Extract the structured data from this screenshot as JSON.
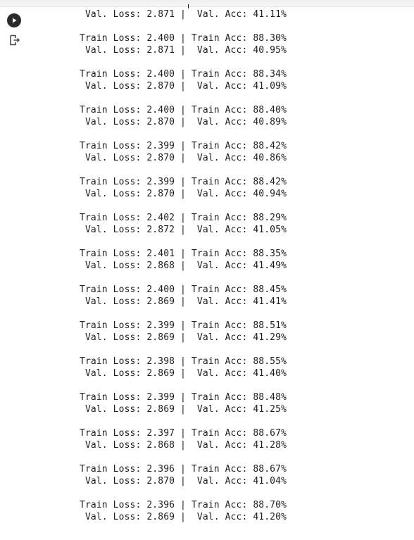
{
  "cell": {
    "run_icon": "play-circle-icon",
    "clear_output_icon": "clear-output-icon"
  },
  "output": {
    "first_val_line": " Val. Loss: 2.871 |  Val. Acc: 41.11%",
    "epochs": [
      {
        "train": "Train Loss: 2.400 | Train Acc: 88.30%",
        "val": " Val. Loss: 2.871 |  Val. Acc: 40.95%"
      },
      {
        "train": "Train Loss: 2.400 | Train Acc: 88.34%",
        "val": " Val. Loss: 2.870 |  Val. Acc: 41.09%"
      },
      {
        "train": "Train Loss: 2.400 | Train Acc: 88.40%",
        "val": " Val. Loss: 2.870 |  Val. Acc: 40.89%"
      },
      {
        "train": "Train Loss: 2.399 | Train Acc: 88.42%",
        "val": " Val. Loss: 2.870 |  Val. Acc: 40.86%"
      },
      {
        "train": "Train Loss: 2.399 | Train Acc: 88.42%",
        "val": " Val. Loss: 2.870 |  Val. Acc: 40.94%"
      },
      {
        "train": "Train Loss: 2.402 | Train Acc: 88.29%",
        "val": " Val. Loss: 2.872 |  Val. Acc: 41.05%"
      },
      {
        "train": "Train Loss: 2.401 | Train Acc: 88.35%",
        "val": " Val. Loss: 2.868 |  Val. Acc: 41.49%"
      },
      {
        "train": "Train Loss: 2.400 | Train Acc: 88.45%",
        "val": " Val. Loss: 2.869 |  Val. Acc: 41.41%"
      },
      {
        "train": "Train Loss: 2.399 | Train Acc: 88.51%",
        "val": " Val. Loss: 2.869 |  Val. Acc: 41.29%"
      },
      {
        "train": "Train Loss: 2.398 | Train Acc: 88.55%",
        "val": " Val. Loss: 2.869 |  Val. Acc: 41.40%"
      },
      {
        "train": "Train Loss: 2.399 | Train Acc: 88.48%",
        "val": " Val. Loss: 2.869 |  Val. Acc: 41.25%"
      },
      {
        "train": "Train Loss: 2.397 | Train Acc: 88.67%",
        "val": " Val. Loss: 2.868 |  Val. Acc: 41.28%"
      },
      {
        "train": "Train Loss: 2.396 | Train Acc: 88.67%",
        "val": " Val. Loss: 2.870 |  Val. Acc: 41.04%"
      },
      {
        "train": "Train Loss: 2.396 | Train Acc: 88.70%",
        "val": " Val. Loss: 2.869 |  Val. Acc: 41.20%"
      }
    ]
  }
}
